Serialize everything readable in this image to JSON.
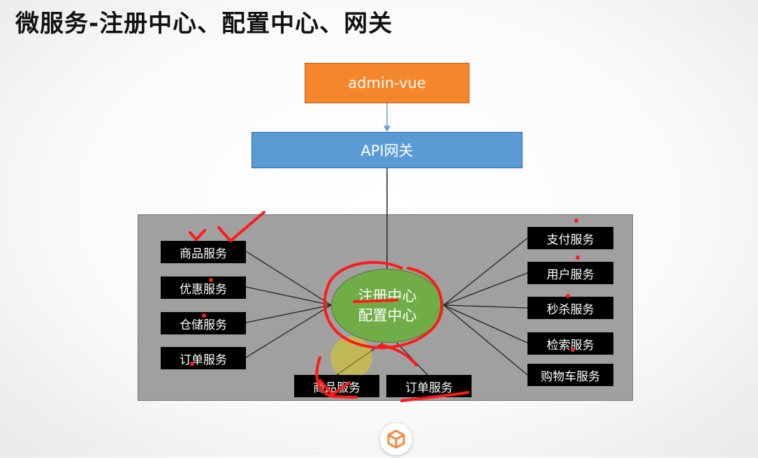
{
  "title": "微服务-注册中心、配置中心、网关",
  "client": {
    "label": "admin-vue"
  },
  "gateway": {
    "label": "API网关"
  },
  "registry": {
    "line1": "注册中心",
    "line2": "配置中心"
  },
  "left_services": [
    "商品服务",
    "优惠服务",
    "仓储服务",
    "订单服务"
  ],
  "bottom_services": [
    "商品服务",
    "订单服务"
  ],
  "right_services": [
    "支付服务",
    "用户服务",
    "秒杀服务",
    "检索服务",
    "购物车服务"
  ],
  "colors": {
    "client": "#f5862c",
    "gateway": "#5b9bd5",
    "registry": "#70ad47",
    "cluster": "#a0a0a0",
    "service": "#000000",
    "annotation": "#ff1a1a"
  },
  "logo_icon": "cube-logo-icon"
}
